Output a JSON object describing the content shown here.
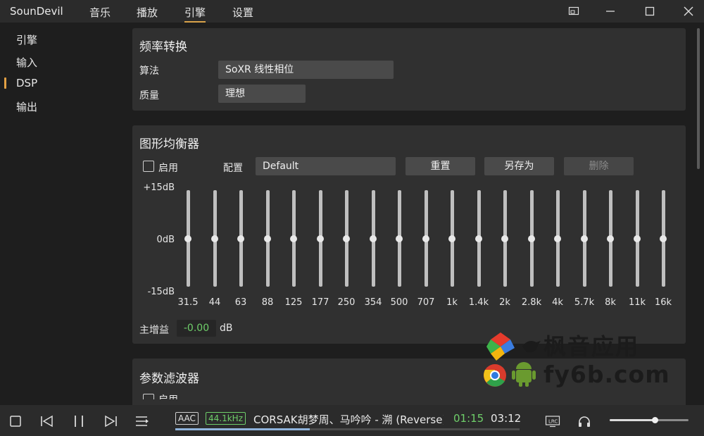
{
  "app": {
    "title": "SounDevil"
  },
  "menu": {
    "items": [
      "音乐",
      "播放",
      "引擎",
      "设置"
    ],
    "active_index": 2
  },
  "sidebar": {
    "items": [
      "引擎",
      "输入",
      "DSP",
      "输出"
    ],
    "active_index": 2
  },
  "resample": {
    "title": "频率转换",
    "algorithm_label": "算法",
    "algorithm_value": "SoXR 线性相位",
    "quality_label": "质量",
    "quality_value": "理想"
  },
  "eq": {
    "title": "图形均衡器",
    "enable_label": "启用",
    "enabled": false,
    "preset_label": "配置",
    "preset_value": "Default",
    "reset_label": "重置",
    "save_as_label": "另存为",
    "delete_label": "删除",
    "db_top": "+15dB",
    "db_mid": "0dB",
    "db_bottom": "-15dB",
    "bands": [
      "31.5",
      "44",
      "63",
      "88",
      "125",
      "177",
      "250",
      "354",
      "500",
      "707",
      "1k",
      "1.4k",
      "2k",
      "2.8k",
      "4k",
      "5.7k",
      "8k",
      "11k",
      "16k"
    ],
    "gains_db": [
      0,
      0,
      0,
      0,
      0,
      0,
      0,
      0,
      0,
      0,
      0,
      0,
      0,
      0,
      0,
      0,
      0,
      0,
      0
    ],
    "master_gain_label": "主增益",
    "master_gain_value": "-0.00",
    "master_gain_unit": "dB"
  },
  "param_filter": {
    "title": "参数滤波器",
    "enable_label": "启用"
  },
  "player": {
    "codec": "AAC",
    "sample_rate": "44.1kHz",
    "track": "CORSAK胡梦周、马吟吟 - 溯 (Reverse)",
    "time_current": "01:15",
    "time_total": "03:12",
    "progress": 0.39,
    "volume": 0.57
  },
  "watermark": {
    "line1": "枫音应用",
    "line2": "fy6b.com"
  },
  "colors": {
    "accent": "#e3a144",
    "green": "#6fcf6a",
    "progress": "#8fb3dc"
  }
}
